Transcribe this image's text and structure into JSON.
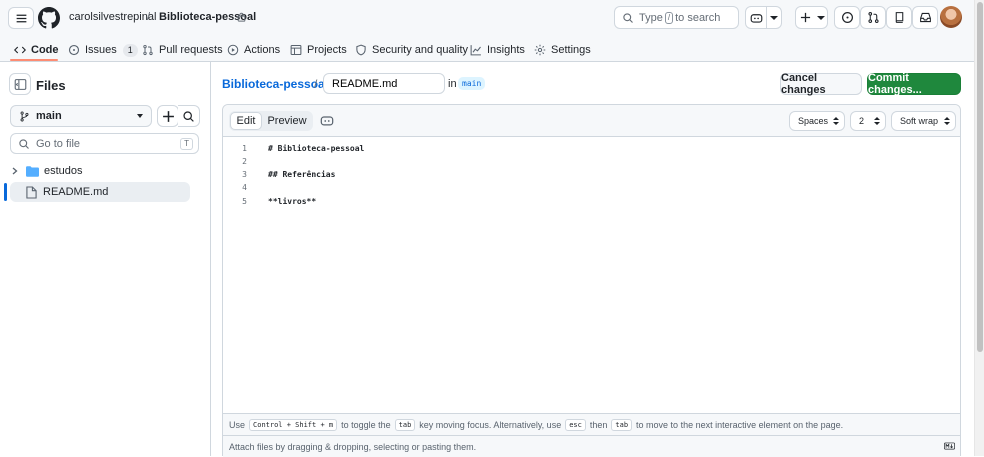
{
  "header": {
    "owner": "carolsilvestrepinal",
    "separator": "/",
    "repo": "Biblioteca-pessoal",
    "search": {
      "prefix": "Type",
      "key": "/",
      "suffix": "to search"
    }
  },
  "repo_tabs": [
    {
      "label": "Code"
    },
    {
      "label": "Issues",
      "count": "1"
    },
    {
      "label": "Pull requests"
    },
    {
      "label": "Actions"
    },
    {
      "label": "Projects"
    },
    {
      "label": "Security and quality"
    },
    {
      "label": "Insights"
    },
    {
      "label": "Settings"
    }
  ],
  "sidebar": {
    "title": "Files",
    "branch": "main",
    "goto_placeholder": "Go to file",
    "goto_key": "T",
    "tree": [
      {
        "label": "estudos",
        "type": "folder"
      },
      {
        "label": "README.md",
        "type": "file",
        "selected": true
      }
    ]
  },
  "breadcrumb": {
    "repo": "Biblioteca-pessoal",
    "separator": "/",
    "filename": "README.md",
    "in_label": "in",
    "branch": "main"
  },
  "actions": {
    "cancel": "Cancel changes",
    "commit": "Commit changes..."
  },
  "editor": {
    "modes": {
      "edit": "Edit",
      "preview": "Preview"
    },
    "indent_mode": "Spaces",
    "indent_size": "2",
    "wrap": "Soft wrap",
    "lines": [
      {
        "n": "1",
        "text": "# Biblioteca-pessoal"
      },
      {
        "n": "2",
        "text": ""
      },
      {
        "n": "3",
        "text": "## Referências"
      },
      {
        "n": "4",
        "text": ""
      },
      {
        "n": "5",
        "text": "**livros**"
      }
    ],
    "footer": {
      "use": "Use",
      "shortcut": "Control + Shift + m",
      "toggle": "to toggle the",
      "tab": "tab",
      "moving": "key moving focus. Alternatively, use",
      "esc": "esc",
      "then": "then",
      "tab2": "tab",
      "rest": "to move to the next interactive element on the page.",
      "attach": "Attach files by dragging & dropping, selecting or pasting them."
    }
  },
  "colors": {
    "accent": "#0969da",
    "commit_green": "#1f883d",
    "active_tab_underline": "#fd8c73"
  }
}
